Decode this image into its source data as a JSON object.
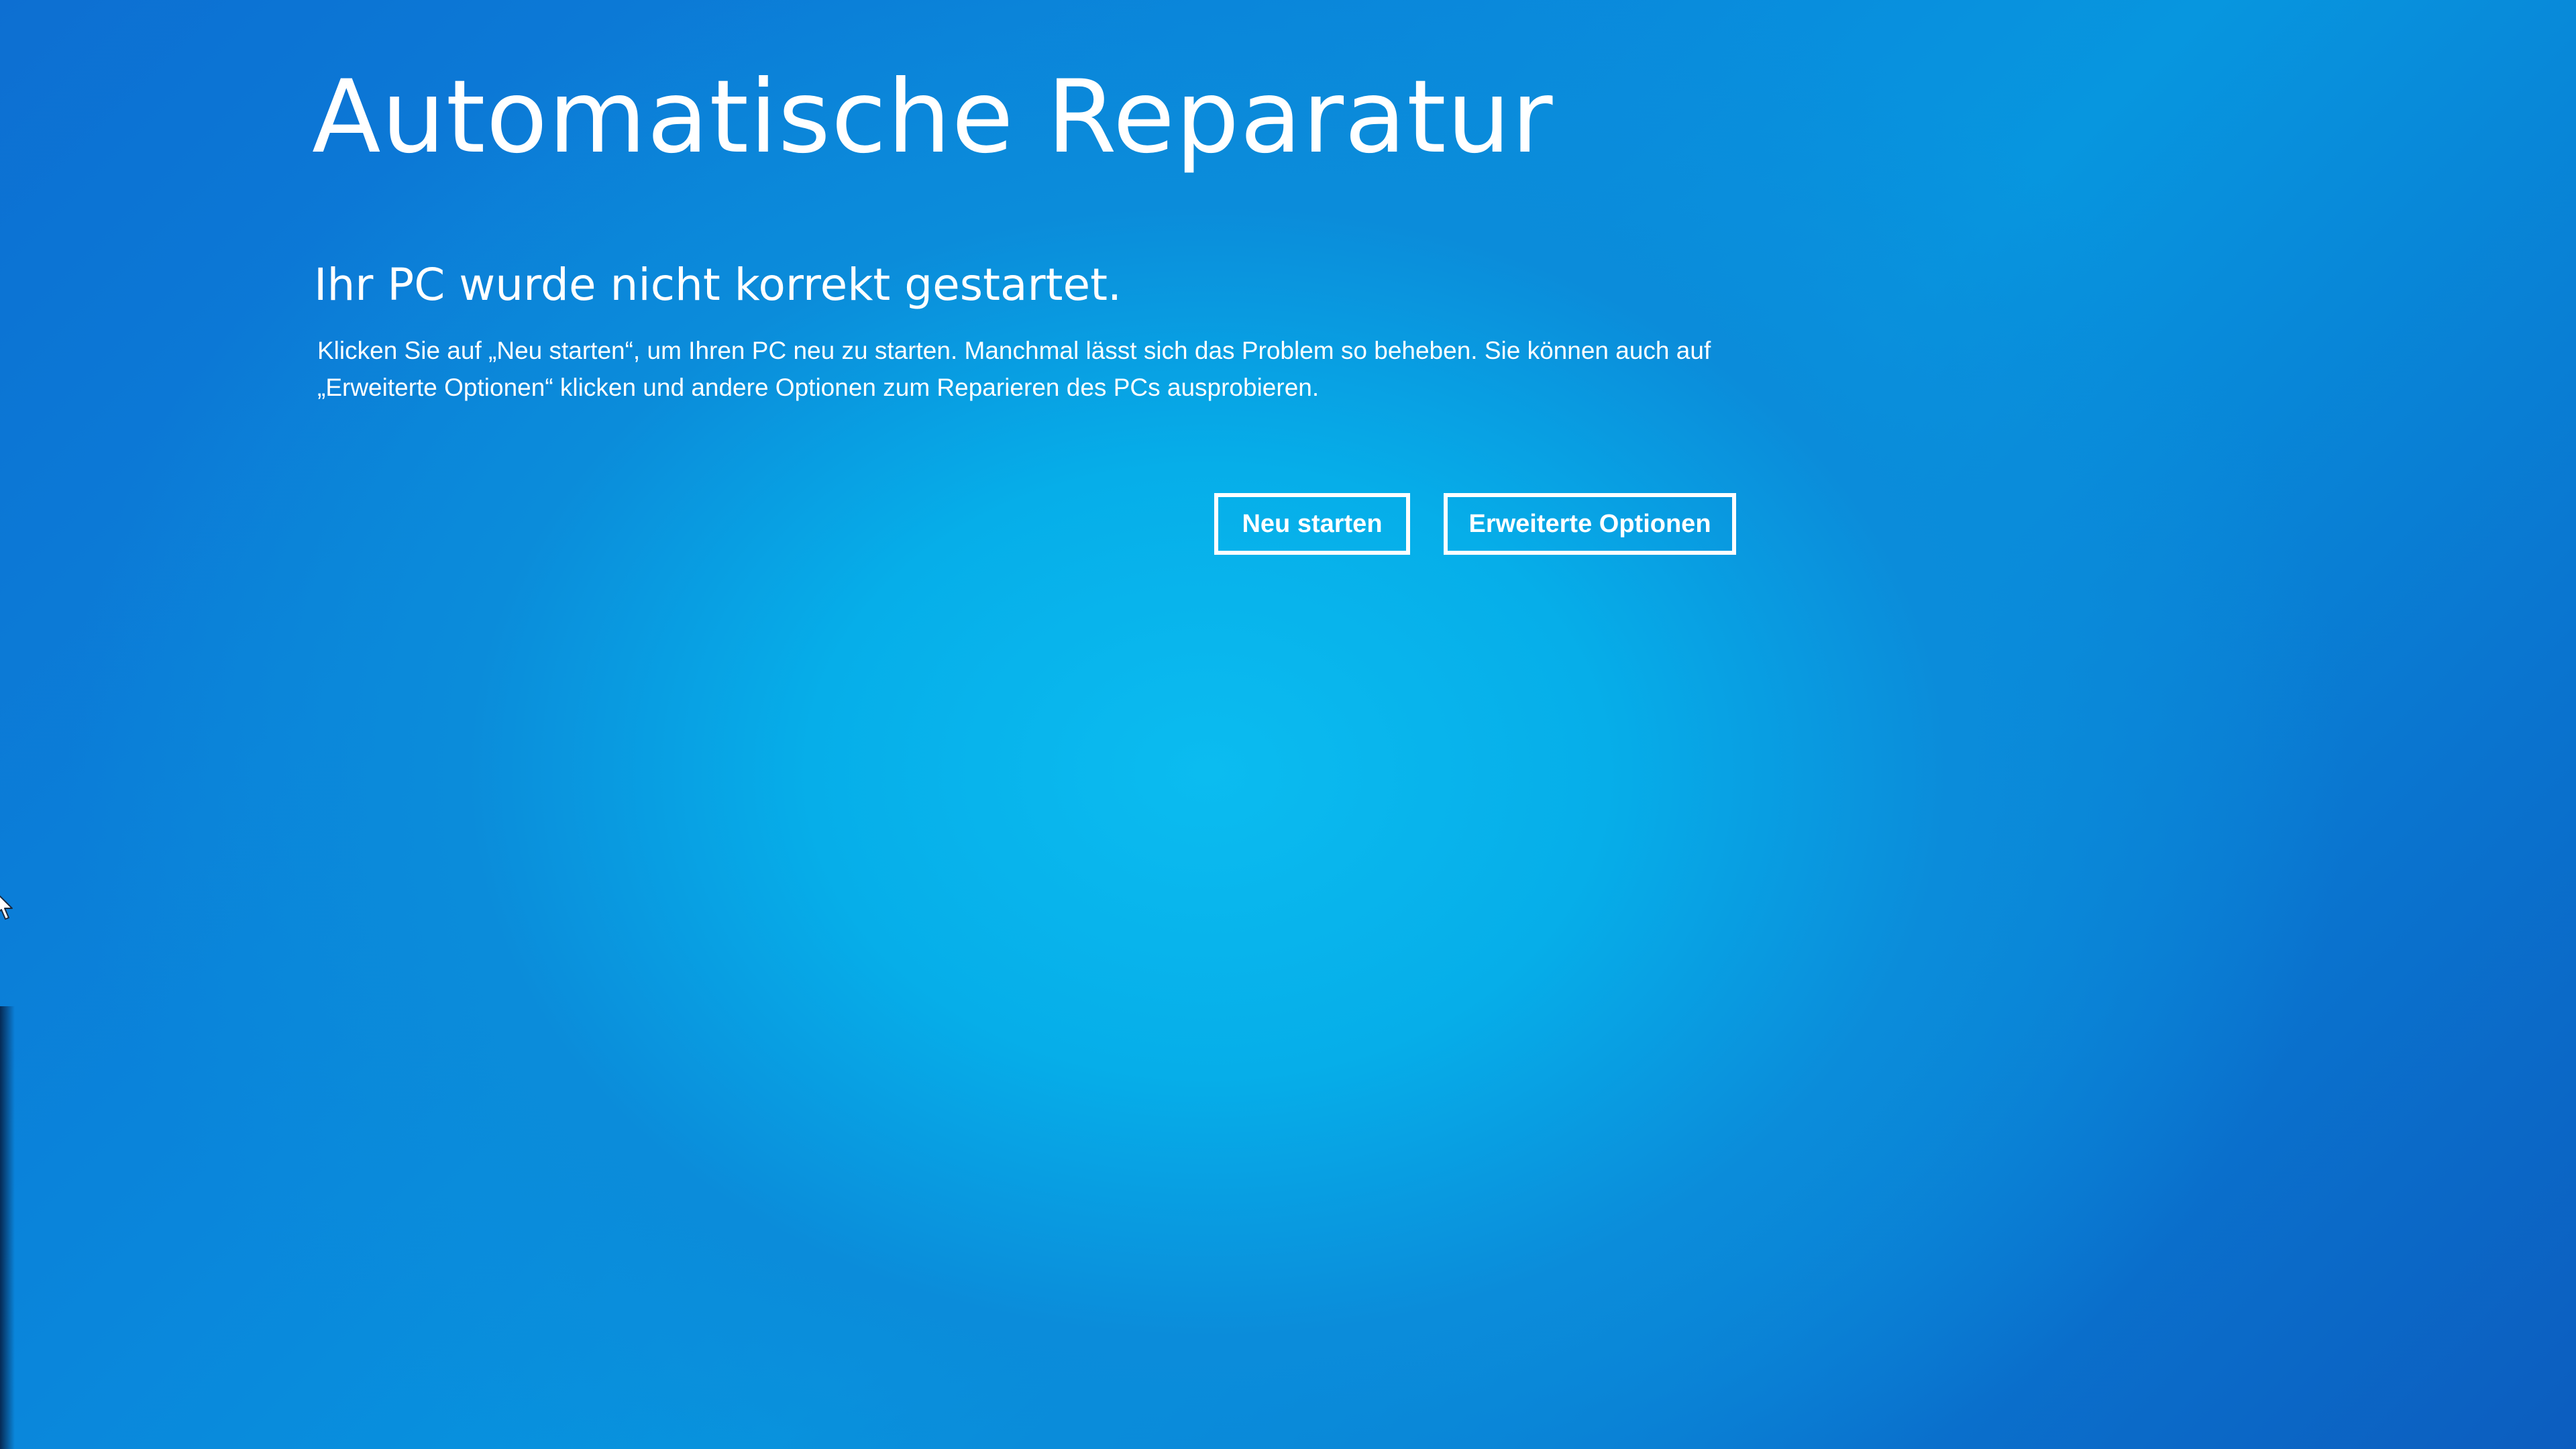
{
  "screen": {
    "title": "Automatische Reparatur",
    "subtitle": "Ihr PC wurde nicht korrekt gestartet.",
    "description": "Klicken Sie auf „Neu starten“, um Ihren PC neu zu starten. Manchmal lässt sich das Problem so beheben. Sie können auch auf „Erweiterte Optionen“ klicken und andere Optionen zum Reparieren des PCs ausprobieren."
  },
  "buttons": {
    "restart_label": "Neu starten",
    "advanced_label": "Erweiterte Optionen"
  },
  "icons": {
    "cursor": "mouse-pointer-icon"
  },
  "colors": {
    "background_center": "#0bbcf0",
    "background_edge": "#0c5dbf",
    "text": "#ffffff"
  }
}
